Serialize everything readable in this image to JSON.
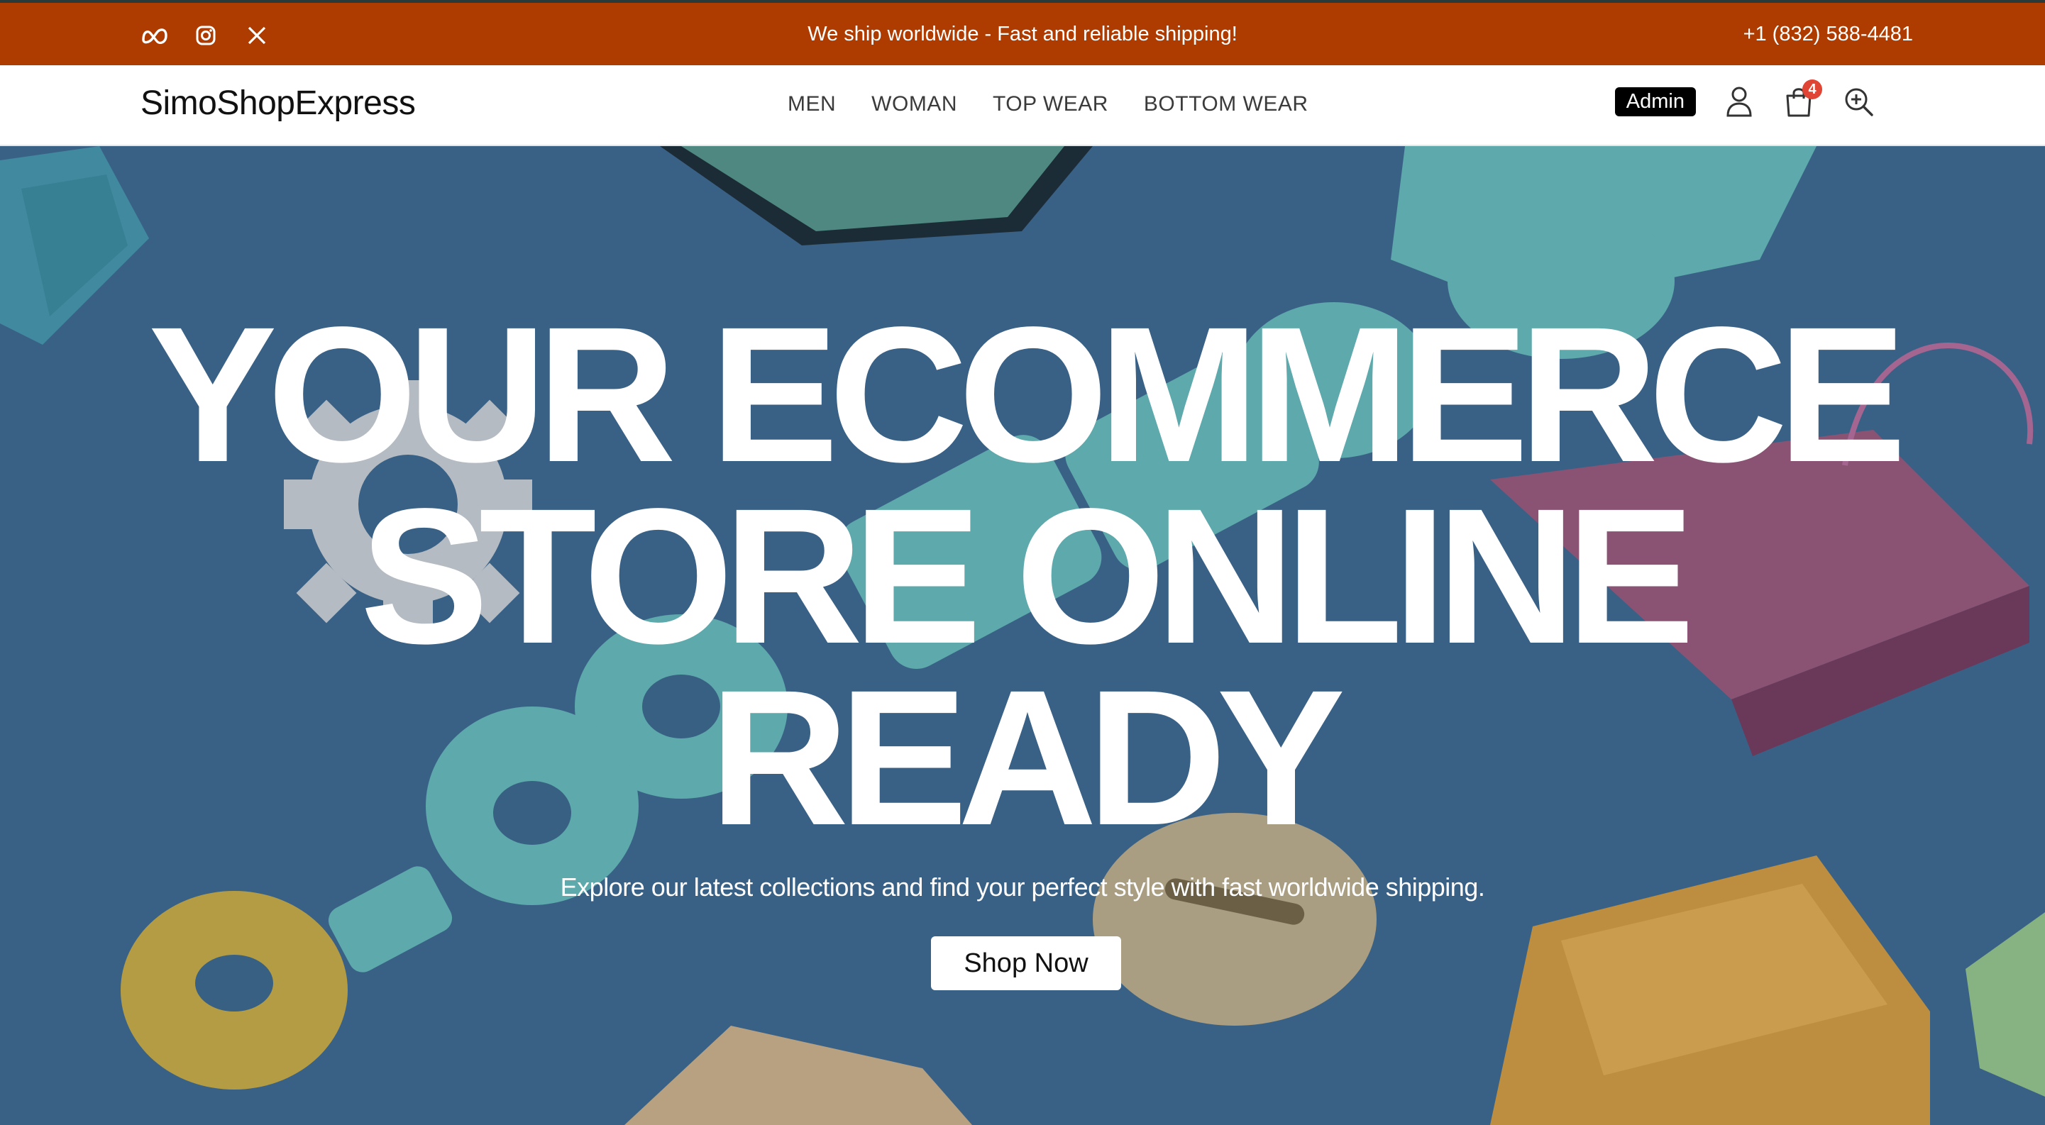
{
  "topbar": {
    "socials": [
      "meta-icon",
      "instagram-icon",
      "x-twitter-icon"
    ],
    "announcement": "We ship worldwide - Fast and reliable shipping!",
    "phone": "+1 (832) 588-4481",
    "background": "#ae3c00"
  },
  "header": {
    "logo": "SimoShopExpress",
    "nav": [
      "MEN",
      "WOMAN",
      "TOP WEAR",
      "BOTTOM WEAR"
    ],
    "admin_label": "Admin",
    "cart_count": "4",
    "icons": [
      "user-icon",
      "shopping-bag-icon",
      "search-icon"
    ]
  },
  "hero": {
    "title_lines": [
      "YOUR ECOMMERCE",
      "STORE ONLINE",
      "READY"
    ],
    "subtitle": "Explore our latest collections and find your perfect style with fast worldwide shipping.",
    "cta": "Shop Now"
  },
  "colors": {
    "accent": "#ae3c00",
    "hero_blue": "#3f6a93",
    "badge": "#e04434"
  }
}
